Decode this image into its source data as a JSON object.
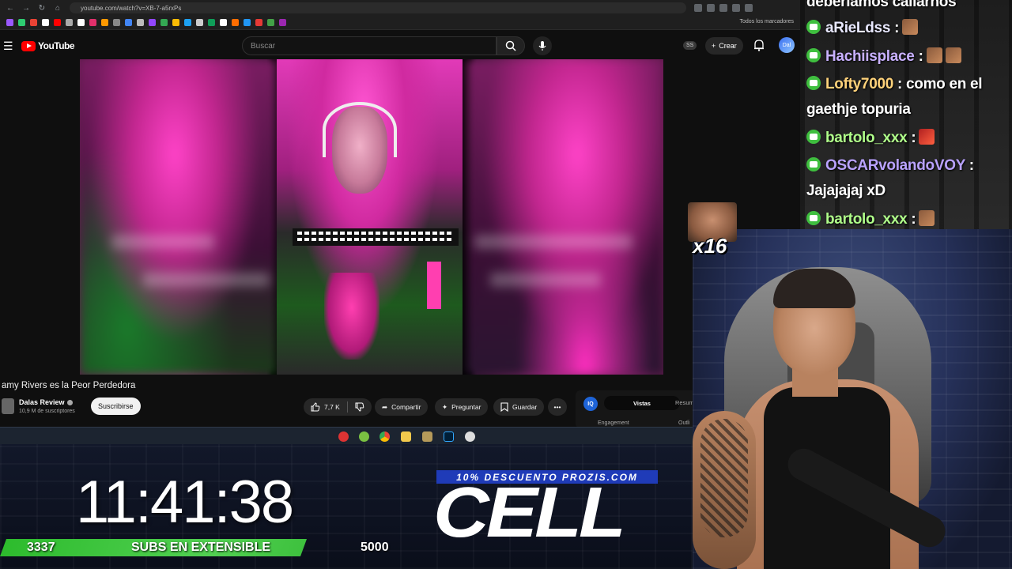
{
  "browser": {
    "url": "youtube.com/watch?v=XB-7-a5rxPs",
    "bookmarks_all": "Todos los marcadores"
  },
  "youtube": {
    "logo_text": "YouTube",
    "search_placeholder": "Buscar",
    "ss_badge": "SS",
    "create_label": "Crear",
    "avatar_text": "Dal"
  },
  "video": {
    "title": "amy Rivers es la Peor Perdedora",
    "channel_name": "Dalas Review",
    "channel_subs": "10,9 M de suscriptores",
    "subscribe_label": "Suscribirse",
    "likes": "7,7 K",
    "share_label": "Compartir",
    "ask_label": "Preguntar",
    "save_label": "Guardar",
    "more_label": "•••"
  },
  "iq_panel": {
    "badge": "IQ",
    "tab_active": "Vistas",
    "tab_other": "Resum",
    "engagement": "Engagement",
    "outlier": "Outli"
  },
  "chat": {
    "messages": [
      {
        "user": "",
        "text": "deberíamos callarnos"
      },
      {
        "user": "aRieLdss",
        "text": ":"
      },
      {
        "user": "Hachiisplace",
        "text": ":"
      },
      {
        "user": "Lofty7000",
        "text": ": como en el"
      },
      {
        "user": "",
        "text": "gaethje topuria"
      },
      {
        "user": "bartolo_xxx",
        "text": ":"
      },
      {
        "user": "OSCARvolandoVOY",
        "text": ":"
      },
      {
        "user": "",
        "text": "Jajajajaj xD"
      },
      {
        "user": "bartolo_xxx",
        "text": ":"
      }
    ],
    "user_colors": {
      "aRieLdss": "#e8e8ff",
      "Hachiisplace": "#c8b0ff",
      "Lofty7000": "#ffd27a",
      "bartolo_xxx": "#b0ff8a",
      "OSCARvolandoVOY": "#b9a2ff"
    }
  },
  "overlay": {
    "emote_multiplier": "x16",
    "timer": "11:41:38",
    "subs_current": "3337",
    "subs_label": "SUBS EN EXTENSIBLE",
    "subs_goal": "5000",
    "promo_text": "10% DESCUENTO PROZIS.COM",
    "brand_text": "CELL"
  },
  "subs_progress": 0.667
}
